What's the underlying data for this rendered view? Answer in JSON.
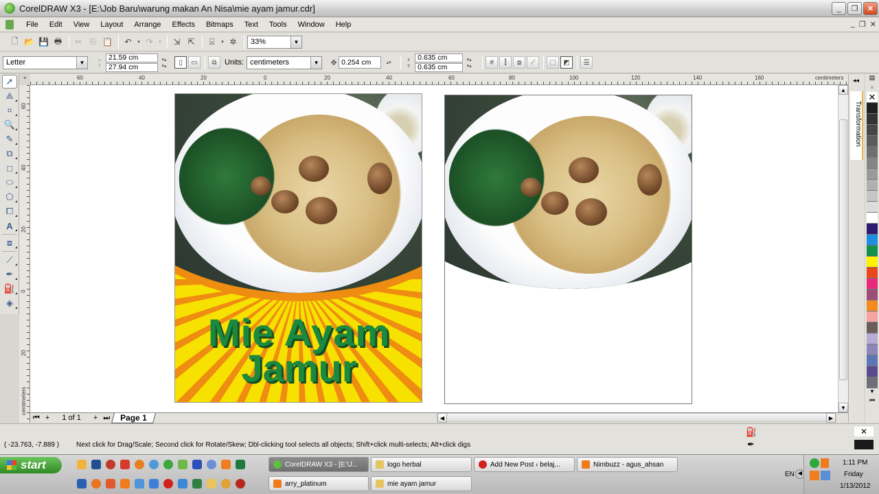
{
  "window": {
    "title": "CorelDRAW X3 - [E:\\Job Baru\\warung makan An Nisa\\mie ayam jamur.cdr]",
    "controls": [
      "minimize",
      "restore",
      "close"
    ]
  },
  "menu": {
    "items": [
      "File",
      "Edit",
      "View",
      "Layout",
      "Arrange",
      "Effects",
      "Bitmaps",
      "Text",
      "Tools",
      "Window",
      "Help"
    ]
  },
  "standard_toolbar": {
    "buttons": [
      "new-icon",
      "open-icon",
      "save-icon",
      "print-icon",
      "cut-icon",
      "copy-icon",
      "paste-icon",
      "undo-icon",
      "redo-icon",
      "import-icon",
      "export-icon",
      "application-launcher-icon",
      "welcome-screen-icon"
    ],
    "zoom_level": "33%"
  },
  "property_bar": {
    "paper_type": "Letter",
    "width": "21.59 cm",
    "height": "27.94 cm",
    "units_label": "Units:",
    "units": "centimeters",
    "nudge": "0.254 cm",
    "duplicate_x": "0.635 cm",
    "duplicate_y": "0.635 cm"
  },
  "rulers": {
    "unit": "centimeters",
    "horizontal_ticks": [
      "60",
      "40",
      "20",
      "0",
      "20",
      "40",
      "60",
      "80",
      "100",
      "120",
      "140",
      "160"
    ],
    "vertical_ticks": [
      "60",
      "40",
      "20",
      "0",
      "20"
    ]
  },
  "toolbox": {
    "tools": [
      "pick-tool",
      "shape-tool",
      "crop-tool",
      "zoom-tool",
      "freehand-tool",
      "smart-fill-tool",
      "rectangle-tool",
      "ellipse-tool",
      "polygon-tool",
      "basic-shapes-tool",
      "text-tool",
      "interactive-blend-tool",
      "eyedropper-tool",
      "outline-tool",
      "fill-tool",
      "interactive-fill-tool"
    ]
  },
  "canvas": {
    "poster_left": {
      "line1": "Mie Ayam",
      "line2": "Jamur"
    },
    "poster_right": {}
  },
  "docker": {
    "tab_label": "Transformation"
  },
  "palette": {
    "colors": [
      "#1f1f1f",
      "#333333",
      "#474747",
      "#5b5b5b",
      "#6f6f6f",
      "#858585",
      "#9a9a9a",
      "#b0b0b0",
      "#c6c6c6",
      "#dcdcdc",
      "#ffffff",
      "#2e1a6e",
      "#1e8ee0",
      "#12914a",
      "#fff200",
      "#e8471b",
      "#e8287a",
      "#9b4d78",
      "#f58a1f",
      "#f5a3a3",
      "#6b5d58",
      "#b7acd6",
      "#8f86b8",
      "#5d75b3",
      "#5a4a8e",
      "#6f6f78"
    ]
  },
  "page_nav": {
    "counter": "1 of 1",
    "tab": "Page 1"
  },
  "status": {
    "coordinates": "( -23.763, -7.889 )",
    "message": "Next click for Drag/Scale; Second click for Rotate/Skew; Dbl-clicking tool selects all objects; Shift+click multi-selects; Alt+click digs"
  },
  "taskbar": {
    "start_label": "start",
    "tasks": [
      {
        "label": "CorelDRAW X3 - [E:\\J...",
        "active": true
      },
      {
        "label": "logo herbal",
        "active": false
      },
      {
        "label": "Add New Post ‹ belaj...",
        "active": false
      },
      {
        "label": "Nimbuzz - agus_ahsan",
        "active": false
      },
      {
        "label": "arry_platinum",
        "active": false
      },
      {
        "label": "mie ayam jamur",
        "active": false
      }
    ],
    "language": "EN",
    "clock": {
      "time": "1:11 PM",
      "day": "Friday",
      "date": "1/13/2012"
    }
  },
  "colors": {
    "accent_green": "#1c8a3e",
    "sunburst_yellow": "#f7e100",
    "sunburst_orange": "#ef8c12"
  }
}
